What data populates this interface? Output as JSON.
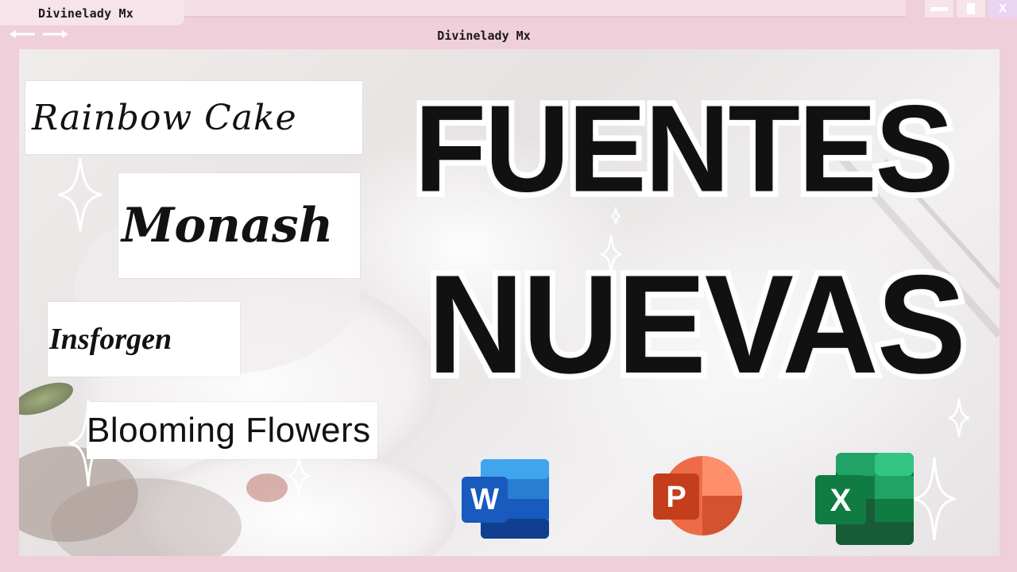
{
  "window": {
    "tab_title": "Divinelady Mx",
    "center_title": "Divinelady Mx",
    "close_label": "X"
  },
  "labels": {
    "rainbow": "Rainbow Cake",
    "monash": "Monash",
    "insforgen": "Insforgen",
    "blooming": "Blooming Flowers"
  },
  "heading": {
    "line1": "FUENTES",
    "line2": "NUEVAS"
  },
  "apps": {
    "word": {
      "letter": "W",
      "color": "#185abd"
    },
    "powerpoint": {
      "letter": "P",
      "color": "#c43e1c"
    },
    "excel": {
      "letter": "X",
      "color": "#107c41"
    }
  },
  "colors": {
    "frame": "#efcfda",
    "text": "#111111"
  }
}
